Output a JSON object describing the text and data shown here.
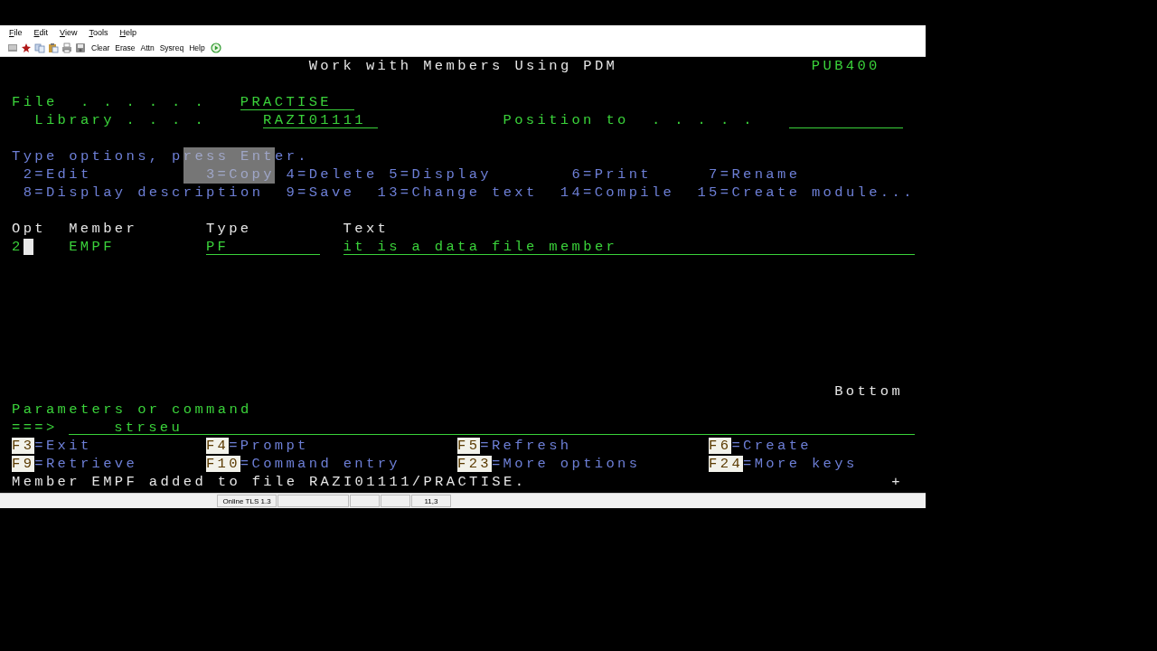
{
  "window": {
    "menu": [
      "File",
      "Edit",
      "View",
      "Tools",
      "Help"
    ],
    "toolbar": [
      "Clear",
      "Erase",
      "Attn",
      "Sysreq",
      "Help"
    ]
  },
  "screen": {
    "title": "Work with Members Using PDM",
    "system": "PUB400",
    "file_label": "File  . . . . . .",
    "file": "PRACTISE",
    "library_label": "Library . . . .",
    "library": "RAZI01111",
    "position_label": "Position to  . . . . .",
    "instruction": "Type options, press Enter.",
    "options": [
      "2=Edit",
      "3=Copy",
      "4=Delete",
      "5=Display",
      "6=Print",
      "7=Rename",
      "8=Display description",
      "9=Save",
      "13=Change text",
      "14=Compile",
      "15=Create module..."
    ],
    "columns": [
      "Opt",
      "Member",
      "Type",
      "Text"
    ],
    "rows": [
      {
        "opt": "2",
        "member": "EMPF",
        "type": "PF",
        "text": "it is a data file member"
      }
    ],
    "more": "Bottom",
    "command_label": "Parameters or command",
    "command_prompt": "===>",
    "command": "strseu",
    "function_keys": [
      {
        "key": "F3",
        "label": "=Exit"
      },
      {
        "key": "F4",
        "label": "=Prompt"
      },
      {
        "key": "F5",
        "label": "=Refresh"
      },
      {
        "key": "F6",
        "label": "=Create"
      },
      {
        "key": "F9",
        "label": "=Retrieve"
      },
      {
        "key": "F10",
        "label": "=Command entry"
      },
      {
        "key": "F23",
        "label": "=More options"
      },
      {
        "key": "F24",
        "label": "=More keys"
      }
    ],
    "message": "Member EMPF added to file RAZI01111/PRACTISE.",
    "more_mark": "+"
  },
  "status_bar": {
    "connection": "Online TLS 1.3",
    "cursor": "11,3"
  }
}
